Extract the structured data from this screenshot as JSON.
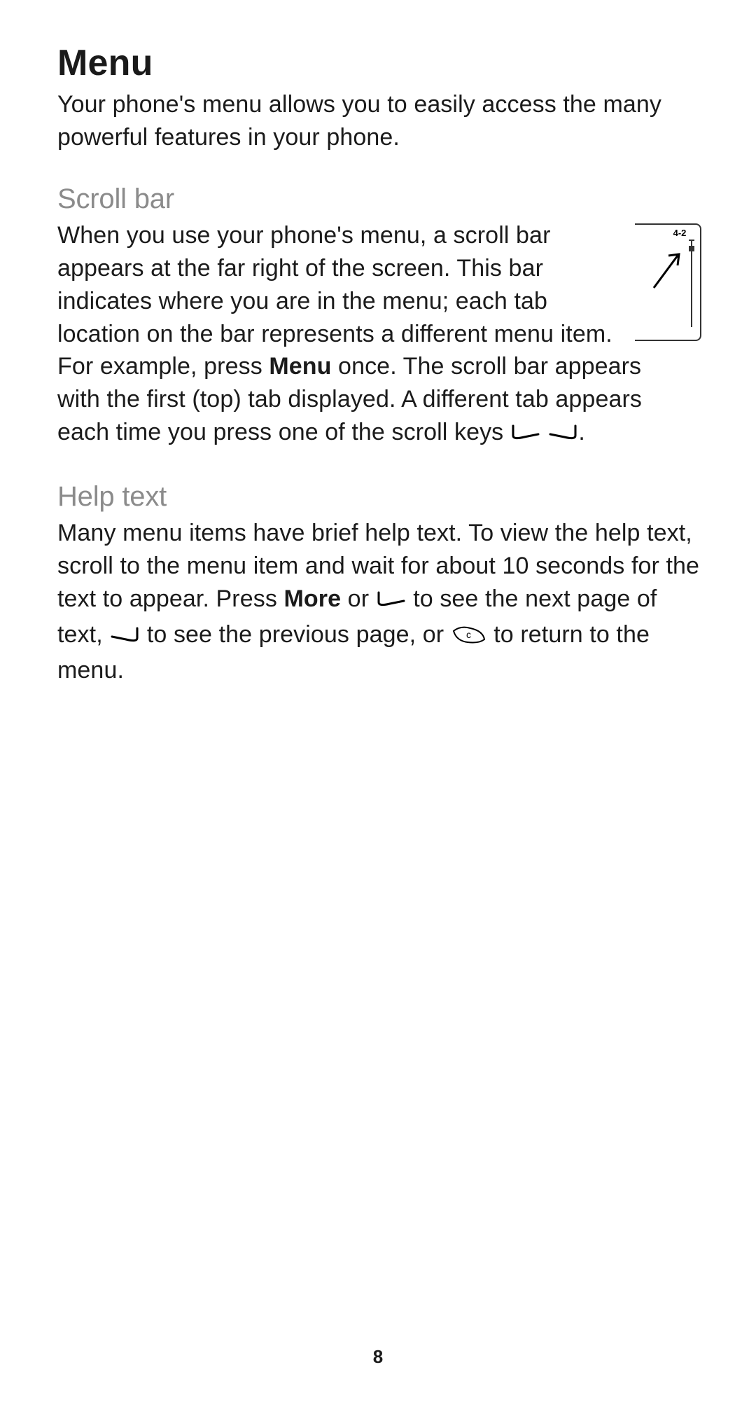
{
  "title": "Menu",
  "intro": "Your phone's menu allows you to easily access the many powerful features in your phone.",
  "scrollbar": {
    "heading": "Scroll bar",
    "body": "When you use your phone's menu, a scroll bar appears at the far right of the screen. This bar indicates where you are in the menu; each tab location on the bar represents a different menu item.",
    "figure_label": "4-2",
    "example_pre": "For example, press ",
    "example_bold": "Menu",
    "example_post_1": " once. The scroll bar appears with the first (top) tab displayed. A different tab appears each time you press one of the scroll keys ",
    "example_post_2": "."
  },
  "helptext": {
    "heading": "Help text",
    "body_1": "Many menu items have brief help text. To view the help text, scroll to the menu item and wait for about 10 seconds for the text to appear. Press ",
    "more": "More",
    "body_2": " or ",
    "body_3": " to see the next page of text, ",
    "body_4": " to see the previous page, or ",
    "body_5": " to return to the menu."
  },
  "page_number": "8"
}
